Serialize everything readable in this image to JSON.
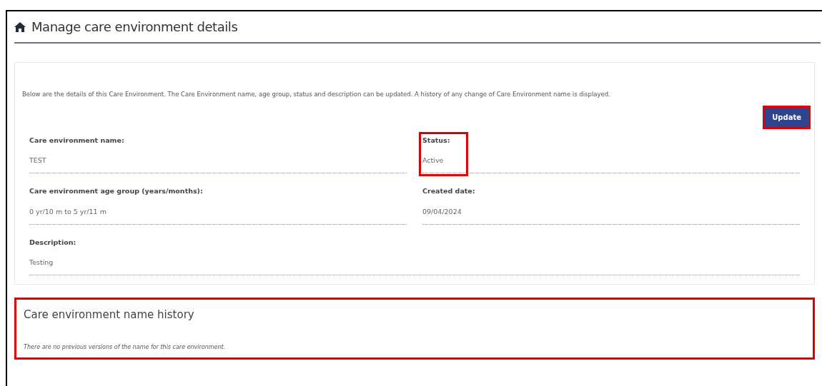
{
  "page": {
    "title": "Manage care environment details"
  },
  "intro": "Below are the details of this Care Environment. The Care Environment name, age group, status and description can be updated. A history of any change of Care Environment name is displayed.",
  "update_button": {
    "label": "Update",
    "highlighted": true
  },
  "fields": [
    {
      "label": "Care environment name:",
      "value": "TEST",
      "kind": "half",
      "highlighted": false
    },
    {
      "label": "Status:",
      "value": "Active",
      "kind": "half",
      "highlighted": true
    },
    {
      "label": "Care environment age group (years/months):",
      "value": "0 yr/10 m to 5 yr/11 m",
      "kind": "half",
      "highlighted": false
    },
    {
      "label": "Created date:",
      "value": "09/04/2024",
      "kind": "half",
      "highlighted": false
    },
    {
      "label": "Description:",
      "value": "Testing",
      "kind": "full",
      "highlighted": false
    }
  ],
  "name_history": {
    "title": "Care environment name history",
    "empty_message": "There are no previous versions of the name for this care environment.",
    "highlighted": true
  }
}
